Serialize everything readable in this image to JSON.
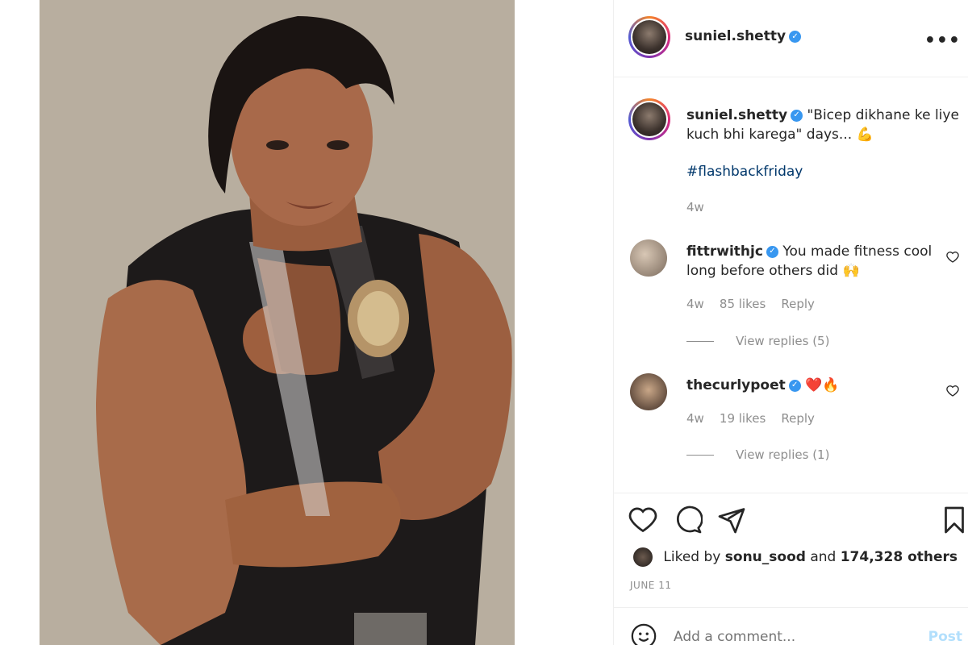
{
  "post": {
    "author": "suniel.shetty",
    "caption_user": "suniel.shetty",
    "caption_text": "\"Bicep dikhane ke liye kuch bhi karega\" days...",
    "caption_emoji": "💪",
    "hashtag": "#flashbackfriday",
    "caption_age": "4w"
  },
  "comments": [
    {
      "user": "fittrwithjc",
      "text": "You made fitness cool long before others did",
      "emoji": "🙌",
      "age": "4w",
      "likes": "85 likes",
      "reply": "Reply",
      "view_replies": "View replies (5)"
    },
    {
      "user": "thecurlypoet",
      "text": "",
      "emoji": "❤️🔥",
      "age": "4w",
      "likes": "19 likes",
      "reply": "Reply",
      "view_replies": "View replies (1)"
    }
  ],
  "likes": {
    "prefix": "Liked by",
    "user": "sonu_sood",
    "middle": "and",
    "others": "174,328 others"
  },
  "date": "JUNE 11",
  "comment_box": {
    "placeholder": "Add a comment...",
    "post_label": "Post"
  },
  "colors": {
    "verified": "#3897f0",
    "secondary_text": "#8e8e8e",
    "hashtag": "#00376b"
  },
  "icons": [
    "more-icon",
    "verified-icon",
    "heart-icon",
    "comment-icon",
    "share-icon",
    "bookmark-icon",
    "emoji-icon"
  ]
}
